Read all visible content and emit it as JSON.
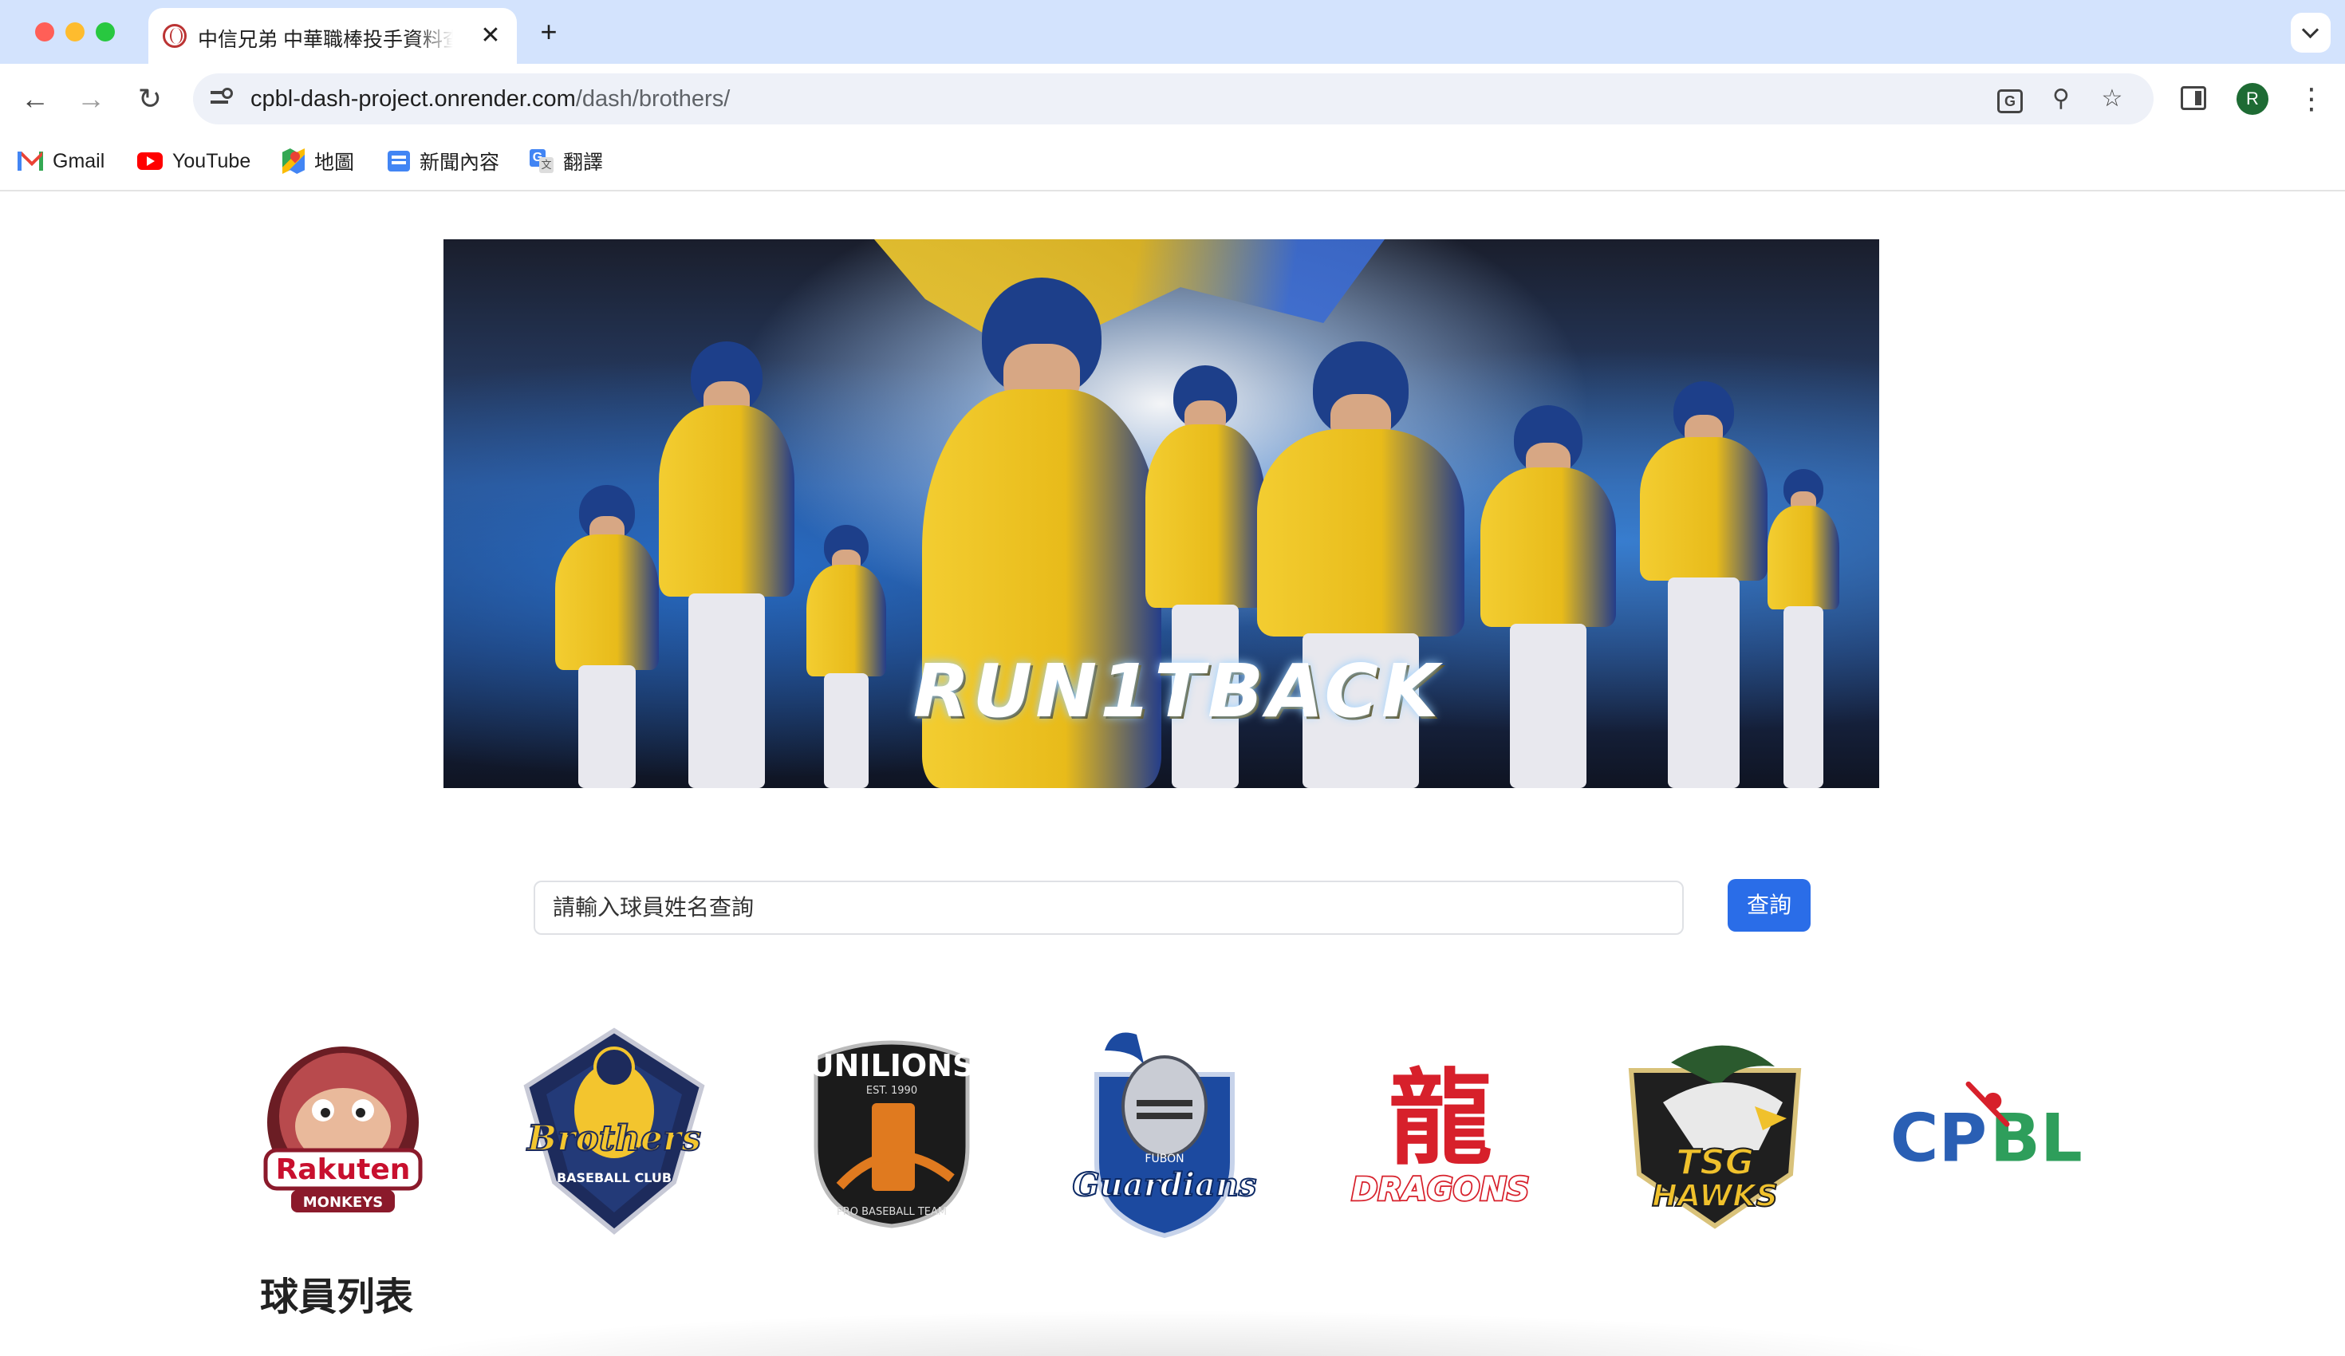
{
  "browser": {
    "tab_title": "中信兄弟 中華職棒投手資料查詢",
    "tab_close": "✕",
    "new_tab": "+",
    "url_host": "cpbl-dash-project.onrender.com",
    "url_path": "/dash/brothers/",
    "avatar_initial": "R",
    "translate_glyph": "G",
    "nav": {
      "back": "←",
      "forward": "→",
      "reload": "↻",
      "zoom": "⚲",
      "star": "☆",
      "menu": "⋮"
    }
  },
  "bookmarks": [
    {
      "label": "Gmail",
      "icon": "gmail-icon"
    },
    {
      "label": "YouTube",
      "icon": "youtube-icon"
    },
    {
      "label": "地圖",
      "icon": "maps-icon"
    },
    {
      "label": "新聞內容",
      "icon": "news-icon"
    },
    {
      "label": "翻譯",
      "icon": "translate-icon"
    }
  ],
  "banner": {
    "title": "RUN1TBACK"
  },
  "search": {
    "placeholder": "請輸入球員姓名查詢",
    "button_label": "查詢"
  },
  "teams": [
    {
      "name": "Rakuten Monkeys",
      "line1": "Rakuten",
      "line2": "MONKEYS",
      "color": "#8b1a2b"
    },
    {
      "name": "Brothers Baseball Club",
      "line1": "Brothers",
      "line2": "BASEBALL CLUB",
      "color": "#1d2b5c"
    },
    {
      "name": "Uni-Lions",
      "line1": "UNILIONS",
      "line2": "EST. 1990",
      "line3": "PRO BASEBALL TEAM",
      "color": "#e07a1f"
    },
    {
      "name": "Fubon Guardians",
      "line1": "FUBON",
      "line2": "Guardians",
      "color": "#1c4aa0"
    },
    {
      "name": "Wei Chuan Dragons",
      "line1": "龍",
      "line2": "DRAGONS",
      "color": "#d7202b"
    },
    {
      "name": "TSG Hawks",
      "line1": "TSG",
      "line2": "HAWKS",
      "color": "#2b5a2e"
    },
    {
      "name": "CPBL",
      "line1": "CP",
      "line2": "BL",
      "color": "#2a5fb4"
    }
  ],
  "section_title": "球員列表"
}
